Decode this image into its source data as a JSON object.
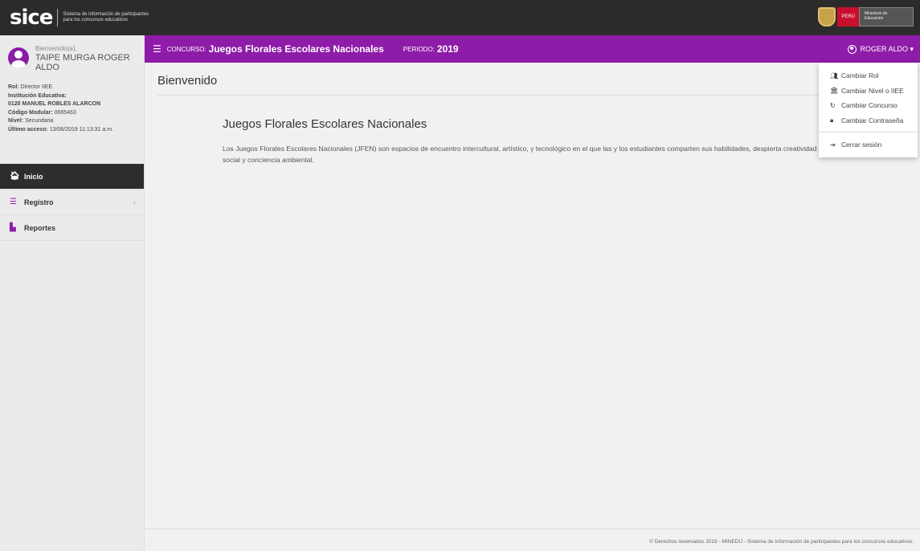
{
  "brand": {
    "logo": "sice",
    "tagline": "Sistema de información de participantes para los concursos educativos",
    "gov_country": "PERÚ",
    "gov_ministry": "Ministerio de Educación"
  },
  "sidebar": {
    "welcome": "Bienvenido(a),",
    "user_full": "TAIPE MURGA ROGER ALDO",
    "meta": [
      {
        "k": "Rol:",
        "v": " Director IIEE"
      },
      {
        "k": "Institución Educativa:",
        "v": ""
      },
      {
        "k": "0120 MANUEL ROBLES ALARCON",
        "v": ""
      },
      {
        "k": "Código Modular:",
        "v": " 0665463"
      },
      {
        "k": "Nivel:",
        "v": " Secundaria"
      },
      {
        "k": "Último acceso:",
        "v": " 13/06/2019 11:13:31 a.m."
      }
    ],
    "nav": [
      {
        "label": "Inicio",
        "icon": "home-icon",
        "active": true
      },
      {
        "label": "Registro",
        "icon": "bars-icon",
        "active": false
      },
      {
        "label": "Reportes",
        "icon": "bar-chart-icon",
        "active": false
      }
    ]
  },
  "header": {
    "concurso_label": "CONCURSO:",
    "concurso_value": "Juegos Florales Escolares Nacionales",
    "periodo_label": "PERIODO:",
    "periodo_value": "2019",
    "user_short": "ROGER ALDO"
  },
  "main": {
    "page_title": "Bienvenido",
    "section_title": "Juegos Florales Escolares Nacionales",
    "description": "Los Juegos Florales Escolares Nacionales (JFEN) son espacios de encuentro intercultural, artístico, y tecnológico en el que las y los estudiantes comparten sus habilidades, despierta creatividad y desarrollan su sensibilidad social y conciencia ambiental."
  },
  "dropdown": {
    "items": [
      {
        "label": "Cambiar Rol",
        "icon": "users-icon"
      },
      {
        "label": "Cambiar Nivel o IIEE",
        "icon": "institution-icon"
      },
      {
        "label": "Cambiar Concurso",
        "icon": "refresh-icon"
      },
      {
        "label": "Cambiar Contraseña",
        "icon": "lock-icon"
      }
    ],
    "logout": "Cerrar sesión"
  },
  "footer": {
    "text": "© Derechos reservados 2019 - MINEDU - Sistema de Información de participantes para los concursos educativos."
  },
  "colors": {
    "accent": "#8e1ca8",
    "topbar": "#2b2b2b",
    "sidebar": "#ebebeb"
  }
}
